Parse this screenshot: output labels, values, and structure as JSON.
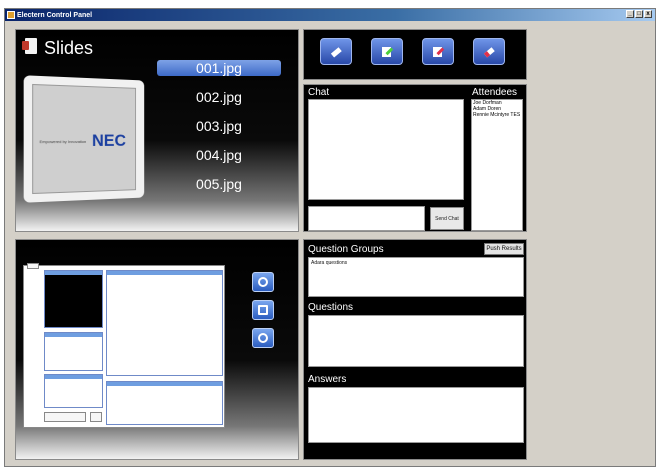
{
  "window": {
    "title": "Electern Control Panel",
    "buttons": [
      "_",
      "□",
      "x"
    ]
  },
  "slides": {
    "title": "Slides",
    "files": [
      "001.jpg",
      "002.jpg",
      "003.jpg",
      "004.jpg",
      "005.jpg"
    ],
    "selected_index": 0,
    "preview_logo": "NEC",
    "preview_tagline": "Empowered by Innovation"
  },
  "toolbar": {
    "buttons": [
      {
        "name": "eraser-button",
        "icon": "eraser-icon",
        "color": "#ffffff"
      },
      {
        "name": "edit-button",
        "icon": "pencil-green-icon",
        "color": "#4ccf3a"
      },
      {
        "name": "highlight-button",
        "icon": "pencil-red-icon",
        "color": "#e0304a"
      },
      {
        "name": "clear-button",
        "icon": "eraser-red-icon",
        "color": "#e0304a"
      }
    ]
  },
  "chat": {
    "label": "Chat",
    "send_label": "Send Chat",
    "input_value": ""
  },
  "attendees": {
    "label": "Attendees",
    "names": [
      "Joe Dorfman",
      "Adam Doren",
      "Rennie Mcintyre TES"
    ]
  },
  "questions": {
    "groups_label": "Question Groups",
    "push_label": "Push Results",
    "groups": [
      "Adara questions"
    ],
    "questions_label": "Questions",
    "answers_label": "Answers"
  },
  "side_buttons": [
    {
      "icon": "refresh-icon"
    },
    {
      "icon": "page-icon"
    },
    {
      "icon": "zoom-icon"
    }
  ]
}
